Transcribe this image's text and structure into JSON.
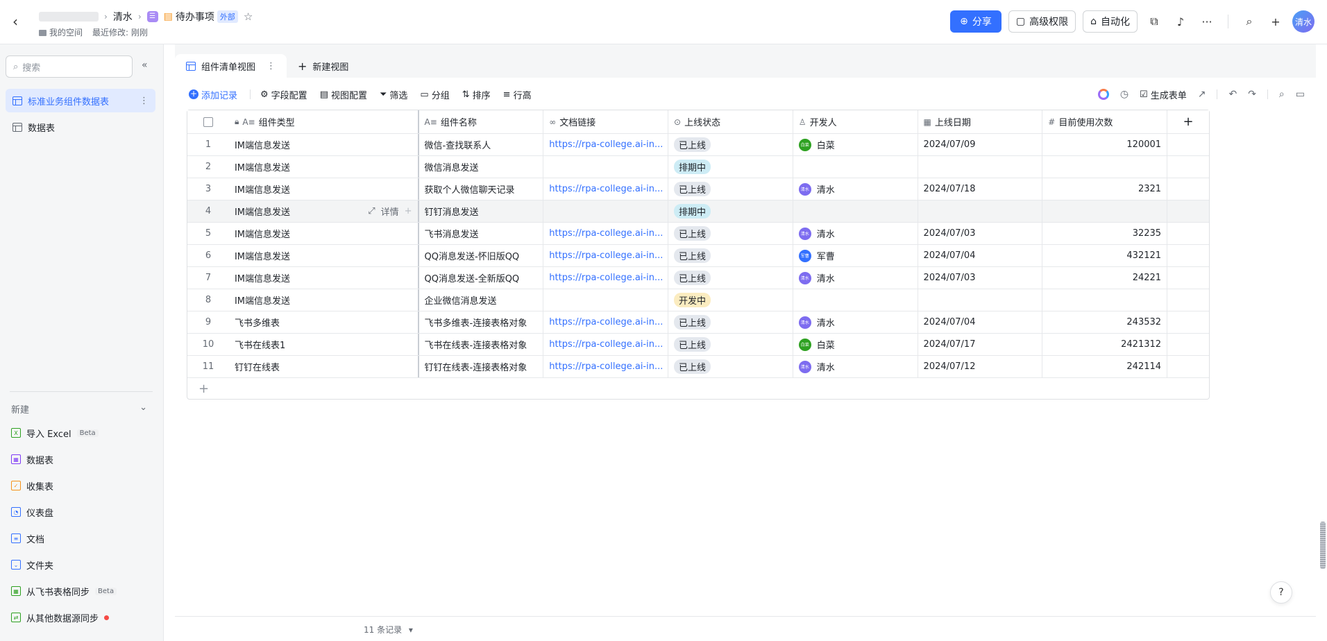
{
  "header": {
    "breadcrumb_parent": "清水",
    "doc_title": "待办事项",
    "doc_badge": "外部",
    "doc_icon_glyph": "☰",
    "location": "我的空间",
    "last_modified": "最近修改: 刚刚",
    "share_label": "分享",
    "permission_label": "高级权限",
    "automation_label": "自动化",
    "user_avatar": "清水"
  },
  "sidebar": {
    "search_placeholder": "搜索",
    "items": [
      {
        "label": "标准业务组件数据表",
        "active": true
      },
      {
        "label": "数据表",
        "active": false
      }
    ],
    "new_header": "新建",
    "new_items": [
      {
        "label": "导入 Excel",
        "badge": "Beta",
        "icon": "excel-icon",
        "color": "#2ea121",
        "glyph": "X"
      },
      {
        "label": "数据表",
        "icon": "table-icon",
        "color": "#7f3bf5",
        "glyph": "▦"
      },
      {
        "label": "收集表",
        "icon": "form-icon",
        "color": "#f5931a",
        "glyph": "✓"
      },
      {
        "label": "仪表盘",
        "icon": "dashboard-icon",
        "color": "#3370ff",
        "glyph": "◔"
      },
      {
        "label": "文档",
        "icon": "doc-icon",
        "color": "#3370ff",
        "glyph": "≡"
      },
      {
        "label": "文件夹",
        "icon": "folder-icon",
        "color": "#3370ff",
        "glyph": "⌄"
      },
      {
        "label": "从飞书表格同步",
        "badge": "Beta",
        "icon": "sheet-sync-icon",
        "color": "#2ea121",
        "glyph": "▦"
      },
      {
        "label": "从其他数据源同步",
        "icon": "datasource-sync-icon",
        "color": "#2ea121",
        "glyph": "⇄",
        "dot": true
      }
    ]
  },
  "tabs": [
    {
      "label": "组件清单视图",
      "active": true
    },
    {
      "label": "新建视图",
      "active": false
    }
  ],
  "toolbar": {
    "add_record": "添加记录",
    "field_config": "字段配置",
    "view_config": "视图配置",
    "filter": "筛选",
    "group": "分组",
    "sort": "排序",
    "row_height": "行高",
    "generate_form": "生成表单"
  },
  "table": {
    "columns": [
      "组件类型",
      "组件名称",
      "文档链接",
      "上线状态",
      "开发人",
      "上线日期",
      "目前使用次数"
    ],
    "detail_label": "详情",
    "hover_row": 3,
    "rows": [
      {
        "idx": "1",
        "type": "IM端信息发送",
        "name": "微信-查找联系人",
        "link": "https://rpa-college.ai-in...",
        "status": "已上线",
        "status_kind": "online",
        "dev": "白菜",
        "dev_avatar": "白菜",
        "dev_color": "#2ea121",
        "date": "2024/07/09",
        "count": "120001"
      },
      {
        "idx": "2",
        "type": "IM端信息发送",
        "name": "微信消息发送",
        "link": "",
        "status": "排期中",
        "status_kind": "sched",
        "dev": "",
        "dev_avatar": "",
        "dev_color": "",
        "date": "",
        "count": ""
      },
      {
        "idx": "3",
        "type": "IM端信息发送",
        "name": "获取个人微信聊天记录",
        "link": "https://rpa-college.ai-in...",
        "status": "已上线",
        "status_kind": "online",
        "dev": "清水",
        "dev_avatar": "清水",
        "dev_color": "#7d6cf0",
        "date": "2024/07/18",
        "count": "2321"
      },
      {
        "idx": "4",
        "type": "IM端信息发送",
        "name": "钉钉消息发送",
        "link": "",
        "status": "排期中",
        "status_kind": "sched",
        "dev": "",
        "dev_avatar": "",
        "dev_color": "",
        "date": "",
        "count": ""
      },
      {
        "idx": "5",
        "type": "IM端信息发送",
        "name": "飞书消息发送",
        "link": "https://rpa-college.ai-in...",
        "status": "已上线",
        "status_kind": "online",
        "dev": "清水",
        "dev_avatar": "清水",
        "dev_color": "#7d6cf0",
        "date": "2024/07/03",
        "count": "32235"
      },
      {
        "idx": "6",
        "type": "IM端信息发送",
        "name": "QQ消息发送-怀旧版QQ",
        "link": "https://rpa-college.ai-in...",
        "status": "已上线",
        "status_kind": "online",
        "dev": "军曹",
        "dev_avatar": "军曹",
        "dev_color": "#3370ff",
        "date": "2024/07/04",
        "count": "432121"
      },
      {
        "idx": "7",
        "type": "IM端信息发送",
        "name": "QQ消息发送-全新版QQ",
        "link": "https://rpa-college.ai-in...",
        "status": "已上线",
        "status_kind": "online",
        "dev": "清水",
        "dev_avatar": "清水",
        "dev_color": "#7d6cf0",
        "date": "2024/07/03",
        "count": "24221"
      },
      {
        "idx": "8",
        "type": "IM端信息发送",
        "name": "企业微信消息发送",
        "link": "",
        "status": "开发中",
        "status_kind": "dev",
        "dev": "",
        "dev_avatar": "",
        "dev_color": "",
        "date": "",
        "count": ""
      },
      {
        "idx": "9",
        "type": "飞书多维表",
        "name": "飞书多维表-连接表格对象",
        "link": "https://rpa-college.ai-in...",
        "status": "已上线",
        "status_kind": "online",
        "dev": "清水",
        "dev_avatar": "清水",
        "dev_color": "#7d6cf0",
        "date": "2024/07/04",
        "count": "243532"
      },
      {
        "idx": "10",
        "type": "飞书在线表1",
        "name": "飞书在线表-连接表格对象",
        "link": "https://rpa-college.ai-in...",
        "status": "已上线",
        "status_kind": "online",
        "dev": "白菜",
        "dev_avatar": "白菜",
        "dev_color": "#2ea121",
        "date": "2024/07/17",
        "count": "2421312"
      },
      {
        "idx": "11",
        "type": "钉钉在线表",
        "name": "钉钉在线表-连接表格对象",
        "link": "https://rpa-college.ai-in...",
        "status": "已上线",
        "status_kind": "online",
        "dev": "清水",
        "dev_avatar": "清水",
        "dev_color": "#7d6cf0",
        "date": "2024/07/12",
        "count": "242114"
      }
    ]
  },
  "footer": {
    "record_count": "11 条记录"
  }
}
